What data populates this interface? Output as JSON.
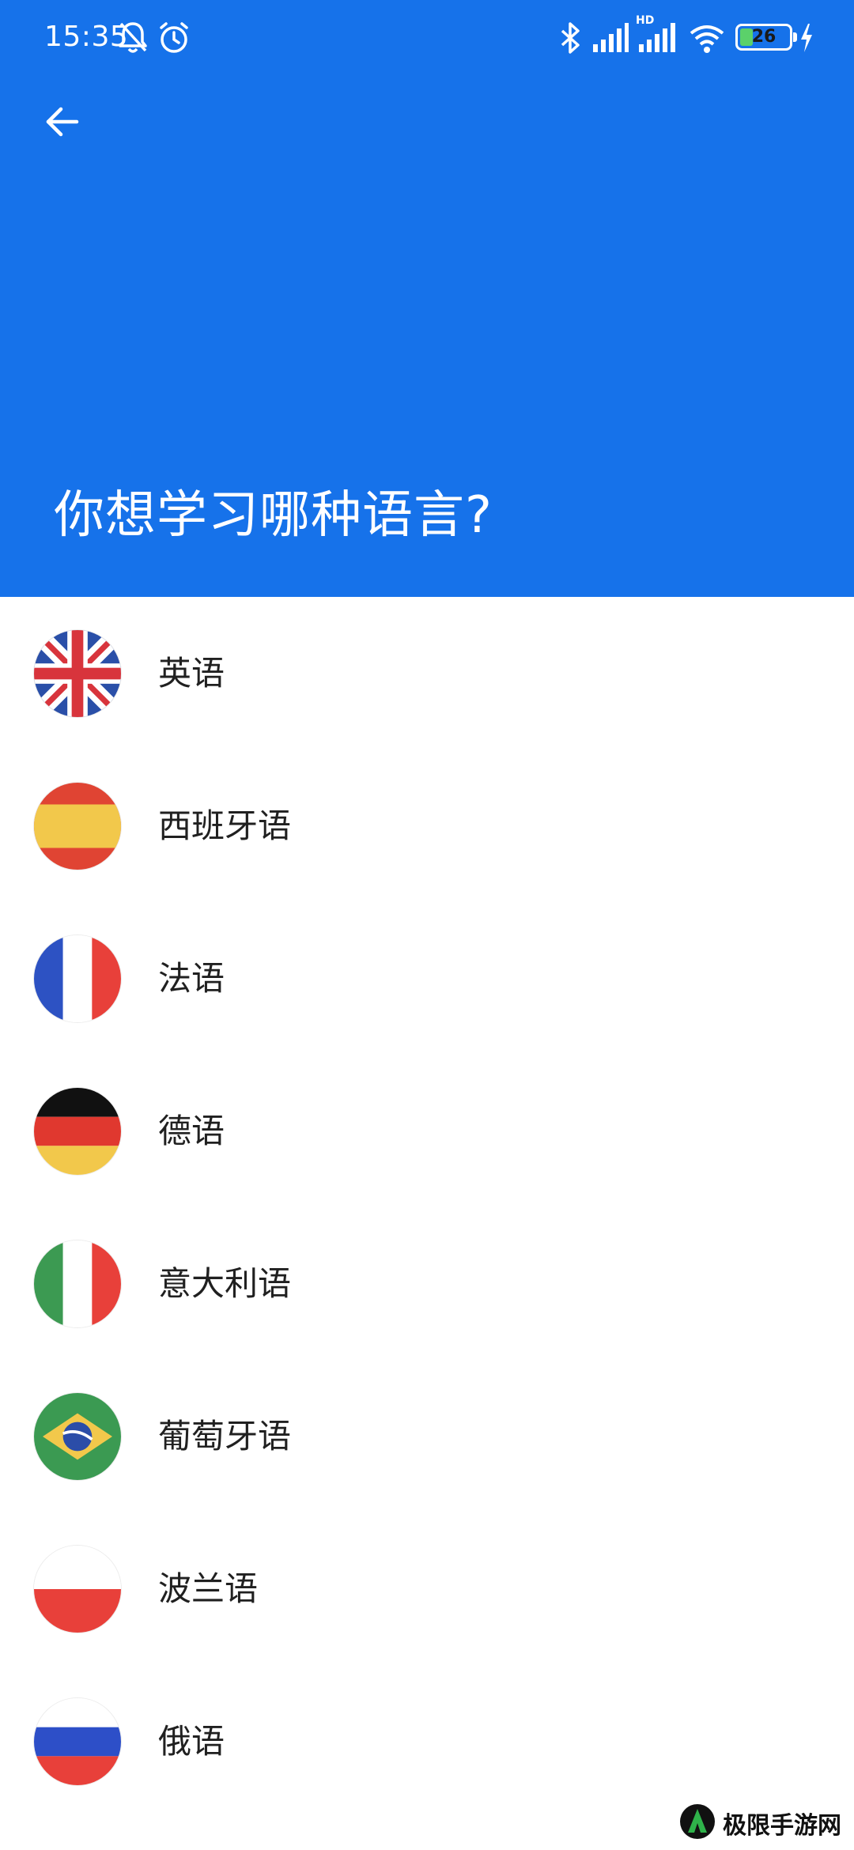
{
  "status_bar": {
    "time": "15:35",
    "battery_level": "26",
    "battery_fraction": 0.26,
    "icons": [
      "bell-off-icon",
      "alarm-icon",
      "bluetooth-icon",
      "signal-icon",
      "hd-signal-icon",
      "wifi-icon",
      "battery-icon",
      "charging-icon"
    ],
    "network_badge": "HD"
  },
  "header": {
    "back_icon": "arrow-left-icon",
    "title": "你想学习哪种语言?",
    "background_color": "#1672ea"
  },
  "languages": [
    {
      "label": "英语",
      "flag": "uk-flag-icon"
    },
    {
      "label": "西班牙语",
      "flag": "spain-flag-icon"
    },
    {
      "label": "法语",
      "flag": "france-flag-icon"
    },
    {
      "label": "德语",
      "flag": "germany-flag-icon"
    },
    {
      "label": "意大利语",
      "flag": "italy-flag-icon"
    },
    {
      "label": "葡萄牙语",
      "flag": "brazil-flag-icon"
    },
    {
      "label": "波兰语",
      "flag": "poland-flag-icon"
    },
    {
      "label": "俄语",
      "flag": "russia-flag-icon"
    }
  ],
  "watermark": {
    "text": "极限手游网"
  }
}
